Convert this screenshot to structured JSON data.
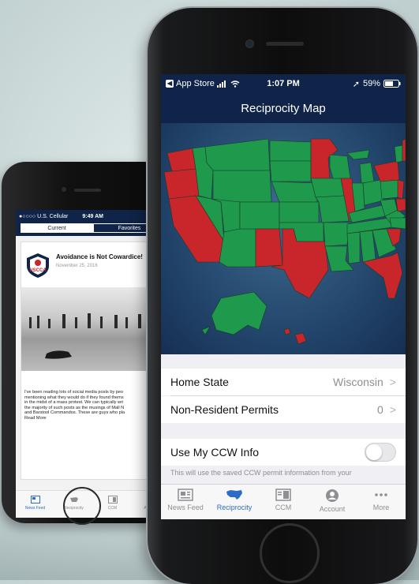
{
  "back_phone": {
    "status": {
      "carrier": "●○○○○ U.S. Cellular",
      "time": "9:49 AM"
    },
    "segments": {
      "current": "Current",
      "favorites": "Favorites"
    },
    "article": {
      "title": "Avoidance is Not Cowardice!",
      "date": "November 25, 2016",
      "excerpt_lines": [
        "I've been reading lots of social media posts by peo",
        "mentioning what they would do if they found thems",
        "in the midst of a mass protest. We can typically wri",
        "the majority of such posts as the musings of Mall N",
        "and Barstool Commandos. These are guys who pla"
      ],
      "read_more": "Read More",
      "logo_text": "USCCA"
    },
    "tabs": [
      {
        "label": "News Feed",
        "icon": "news-icon",
        "active": true
      },
      {
        "label": "Reciprocity",
        "icon": "map-icon",
        "active": false
      },
      {
        "label": "CCM",
        "icon": "magazine-icon",
        "active": false
      },
      {
        "label": "Account",
        "icon": "account-icon",
        "active": false
      }
    ]
  },
  "front_phone": {
    "status": {
      "back_app": "App Store",
      "time": "1:07 PM",
      "battery": "59%"
    },
    "title": "Reciprocity Map",
    "map_colors": {
      "honored": "#1f9a4c",
      "not_honored": "#c8262b",
      "ocean": "#23466c"
    },
    "settings": {
      "home_state_label": "Home State",
      "home_state_value": "Wisconsin",
      "permits_label": "Non-Resident Permits",
      "permits_value": "0",
      "ccw_label": "Use My CCW Info",
      "ccw_enabled": false,
      "ccw_note": "This will use the saved CCW permit information from your"
    },
    "tabs": [
      {
        "label": "News Feed",
        "icon": "news-icon",
        "active": false
      },
      {
        "label": "Reciprocity",
        "icon": "map-icon",
        "active": true
      },
      {
        "label": "CCM",
        "icon": "magazine-icon",
        "active": false
      },
      {
        "label": "Account",
        "icon": "account-icon",
        "active": false
      },
      {
        "label": "More",
        "icon": "more-icon",
        "active": false
      }
    ]
  }
}
